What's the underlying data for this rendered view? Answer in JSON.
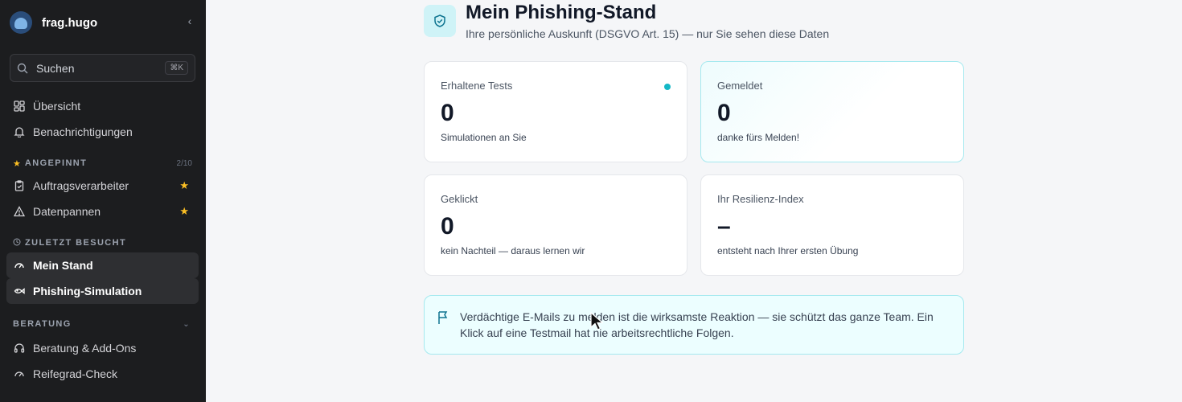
{
  "sidebar": {
    "brand": "frag.hugo",
    "search": {
      "placeholder": "Suchen",
      "shortcut": "⌘K"
    },
    "top_items": [
      {
        "label": "Übersicht",
        "icon": "grid-icon"
      },
      {
        "label": "Benachrichtigungen",
        "icon": "bell-icon"
      }
    ],
    "pinned": {
      "title": "ANGEPINNT",
      "count": "2/10",
      "items": [
        {
          "label": "Auftragsverarbeiter",
          "icon": "clipboard-icon"
        },
        {
          "label": "Datenpannen",
          "icon": "warning-icon"
        }
      ]
    },
    "recent": {
      "title": "ZULETZT BESUCHT",
      "items": [
        {
          "label": "Mein Stand",
          "icon": "gauge-icon"
        },
        {
          "label": "Phishing-Simulation",
          "icon": "fish-icon"
        }
      ]
    },
    "consulting": {
      "title": "BERATUNG",
      "items": [
        {
          "label": "Beratung & Add-Ons",
          "icon": "headset-icon"
        },
        {
          "label": "Reifegrad-Check",
          "icon": "gauge-icon"
        }
      ]
    }
  },
  "main": {
    "title": "Mein Phishing-Stand",
    "subtitle": "Ihre persönliche Auskunft (DSGVO Art. 15) — nur Sie sehen diese Daten",
    "cards": [
      {
        "label": "Erhaltene Tests",
        "value": "0",
        "note": "Simulationen an Sie"
      },
      {
        "label": "Gemeldet",
        "value": "0",
        "note": "danke fürs Melden!"
      },
      {
        "label": "Geklickt",
        "value": "0",
        "note": "kein Nachteil — daraus lernen wir"
      },
      {
        "label": "Ihr Resilienz-Index",
        "value": "–",
        "note": "entsteht nach Ihrer ersten Übung"
      }
    ],
    "info": "Verdächtige E-Mails zu melden ist die wirksamste Reaktion — sie schützt das ganze Team. Ein Klick auf eine Testmail hat nie arbeitsrechtliche Folgen."
  },
  "colors": {
    "accent": "#14b8c6",
    "sidebar_bg": "#1c1d1f",
    "star": "#fbbf24"
  }
}
